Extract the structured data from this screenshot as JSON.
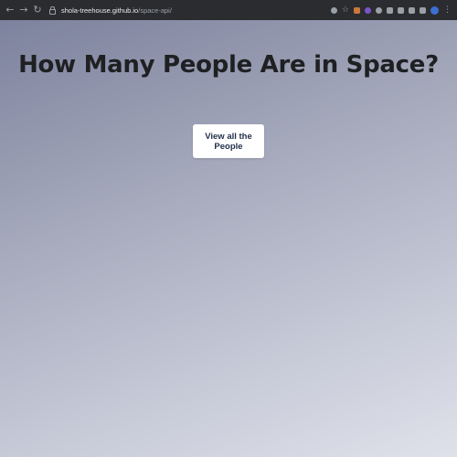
{
  "browser": {
    "back_icon": "←",
    "forward_icon": "→",
    "reload_icon": "↻",
    "url_host": "shola-treehouse.github.io",
    "url_path": "/space-api/",
    "star_icon": "☆",
    "menu_icon": "⋮",
    "colors": {
      "bar": "#2b2c30",
      "text": "#e8eaed"
    }
  },
  "page": {
    "title": "How Many People Are in Space?",
    "button_label": "View all the People"
  }
}
